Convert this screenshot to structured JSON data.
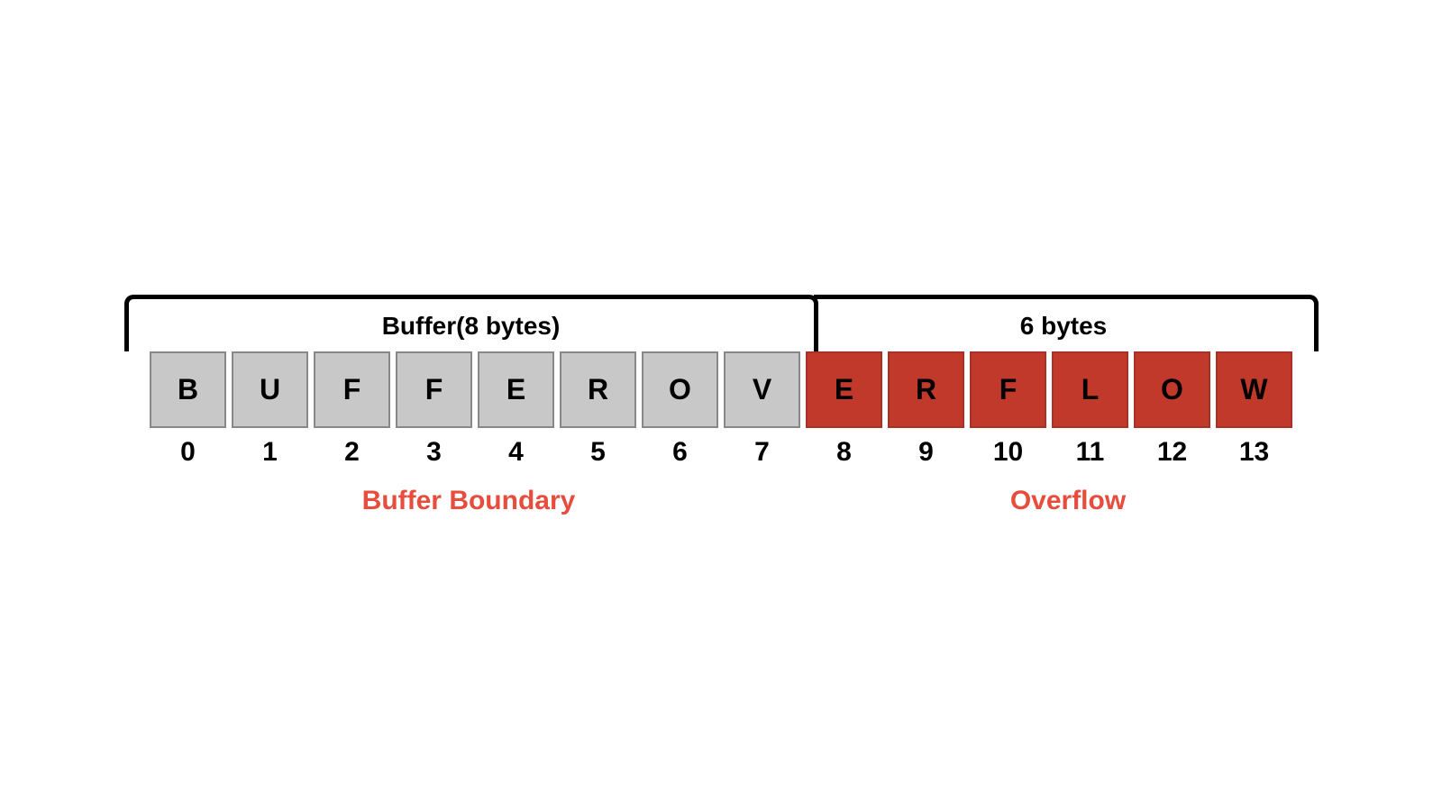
{
  "diagram": {
    "buffer_label": "Buffer(8 bytes)",
    "overflow_section_label": "6 bytes",
    "buffer_cells": [
      "B",
      "U",
      "F",
      "F",
      "E",
      "R",
      "O",
      "V"
    ],
    "overflow_cells": [
      "E",
      "R",
      "F",
      "L",
      "O",
      "W"
    ],
    "indices": [
      0,
      1,
      2,
      3,
      4,
      5,
      6,
      7,
      8,
      9,
      10,
      11,
      12,
      13
    ],
    "boundary_text": "Buffer Boundary",
    "overflow_text": "Overflow",
    "colors": {
      "gray_cell": "#c8c8c8",
      "red_cell": "#c0392b",
      "label_red": "#e74c3c",
      "black": "#000000",
      "white": "#ffffff"
    }
  }
}
